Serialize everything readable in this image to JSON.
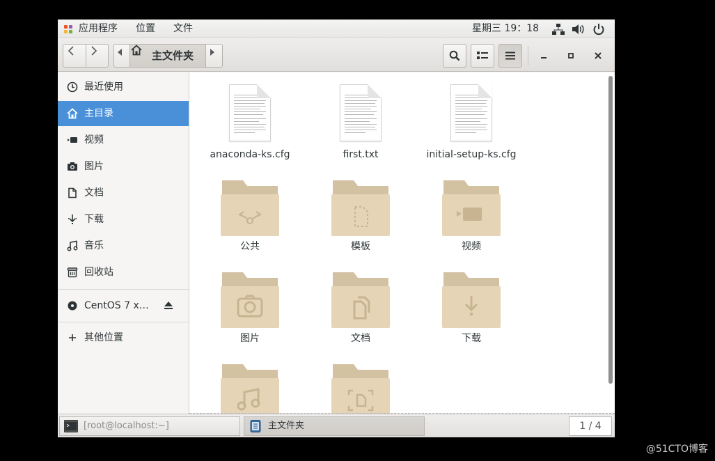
{
  "top_panel": {
    "menus": [
      "应用程序",
      "位置",
      "文件"
    ],
    "clock": "星期三 19：18"
  },
  "header": {
    "path_label": "主文件夹"
  },
  "sidebar": {
    "items": [
      {
        "label": "最近使用",
        "icon": "clock-icon"
      },
      {
        "label": "主目录",
        "icon": "home-icon",
        "active": true
      },
      {
        "label": "视频",
        "icon": "video-icon"
      },
      {
        "label": "图片",
        "icon": "camera-icon"
      },
      {
        "label": "文档",
        "icon": "document-icon"
      },
      {
        "label": "下载",
        "icon": "download-icon"
      },
      {
        "label": "音乐",
        "icon": "music-icon"
      },
      {
        "label": "回收站",
        "icon": "trash-icon"
      }
    ],
    "device": {
      "label": "CentOS 7 x…",
      "icon": "disc-icon",
      "eject_icon": "eject-icon"
    },
    "other": {
      "label": "其他位置",
      "icon": "plus-icon"
    }
  },
  "files": [
    {
      "name": "anaconda-ks.cfg",
      "type": "text"
    },
    {
      "name": "first.txt",
      "type": "text"
    },
    {
      "name": "initial-setup-ks.cfg",
      "type": "text"
    },
    {
      "name": "公共",
      "type": "folder",
      "emblem": "share-icon"
    },
    {
      "name": "模板",
      "type": "folder",
      "emblem": "template-icon"
    },
    {
      "name": "视频",
      "type": "folder",
      "emblem": "video-icon"
    },
    {
      "name": "图片",
      "type": "folder",
      "emblem": "camera-icon"
    },
    {
      "name": "文档",
      "type": "folder",
      "emblem": "document-icon"
    },
    {
      "name": "下载",
      "type": "folder",
      "emblem": "download-icon"
    },
    {
      "name": "",
      "type": "folder",
      "emblem": "music-icon"
    },
    {
      "name": "",
      "type": "folder",
      "emblem": "desktop-icon"
    }
  ],
  "taskbar": {
    "terminal_label": "[root@localhost:~]",
    "files_label": "主文件夹",
    "pager": "1 / 4"
  },
  "watermark": "@51CTO博客",
  "colors": {
    "accent": "#4a90d9",
    "folder": "#e6d4b7",
    "folder_tab": "#d3c2a2"
  }
}
